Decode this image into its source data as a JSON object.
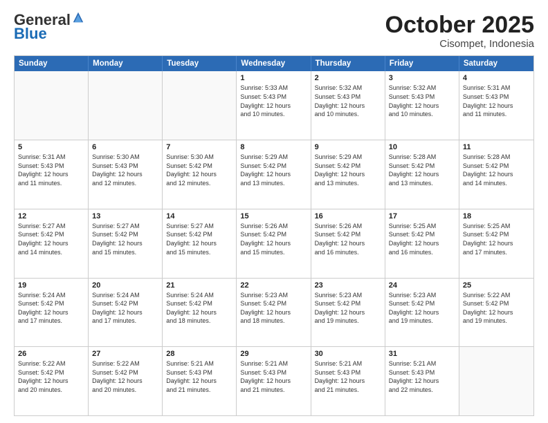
{
  "header": {
    "logo_general": "General",
    "logo_blue": "Blue",
    "month_title": "October 2025",
    "location": "Cisompet, Indonesia"
  },
  "days_of_week": [
    "Sunday",
    "Monday",
    "Tuesday",
    "Wednesday",
    "Thursday",
    "Friday",
    "Saturday"
  ],
  "rows": [
    [
      {
        "day": "",
        "info": ""
      },
      {
        "day": "",
        "info": ""
      },
      {
        "day": "",
        "info": ""
      },
      {
        "day": "1",
        "info": "Sunrise: 5:33 AM\nSunset: 5:43 PM\nDaylight: 12 hours\nand 10 minutes."
      },
      {
        "day": "2",
        "info": "Sunrise: 5:32 AM\nSunset: 5:43 PM\nDaylight: 12 hours\nand 10 minutes."
      },
      {
        "day": "3",
        "info": "Sunrise: 5:32 AM\nSunset: 5:43 PM\nDaylight: 12 hours\nand 10 minutes."
      },
      {
        "day": "4",
        "info": "Sunrise: 5:31 AM\nSunset: 5:43 PM\nDaylight: 12 hours\nand 11 minutes."
      }
    ],
    [
      {
        "day": "5",
        "info": "Sunrise: 5:31 AM\nSunset: 5:43 PM\nDaylight: 12 hours\nand 11 minutes."
      },
      {
        "day": "6",
        "info": "Sunrise: 5:30 AM\nSunset: 5:43 PM\nDaylight: 12 hours\nand 12 minutes."
      },
      {
        "day": "7",
        "info": "Sunrise: 5:30 AM\nSunset: 5:42 PM\nDaylight: 12 hours\nand 12 minutes."
      },
      {
        "day": "8",
        "info": "Sunrise: 5:29 AM\nSunset: 5:42 PM\nDaylight: 12 hours\nand 13 minutes."
      },
      {
        "day": "9",
        "info": "Sunrise: 5:29 AM\nSunset: 5:42 PM\nDaylight: 12 hours\nand 13 minutes."
      },
      {
        "day": "10",
        "info": "Sunrise: 5:28 AM\nSunset: 5:42 PM\nDaylight: 12 hours\nand 13 minutes."
      },
      {
        "day": "11",
        "info": "Sunrise: 5:28 AM\nSunset: 5:42 PM\nDaylight: 12 hours\nand 14 minutes."
      }
    ],
    [
      {
        "day": "12",
        "info": "Sunrise: 5:27 AM\nSunset: 5:42 PM\nDaylight: 12 hours\nand 14 minutes."
      },
      {
        "day": "13",
        "info": "Sunrise: 5:27 AM\nSunset: 5:42 PM\nDaylight: 12 hours\nand 15 minutes."
      },
      {
        "day": "14",
        "info": "Sunrise: 5:27 AM\nSunset: 5:42 PM\nDaylight: 12 hours\nand 15 minutes."
      },
      {
        "day": "15",
        "info": "Sunrise: 5:26 AM\nSunset: 5:42 PM\nDaylight: 12 hours\nand 15 minutes."
      },
      {
        "day": "16",
        "info": "Sunrise: 5:26 AM\nSunset: 5:42 PM\nDaylight: 12 hours\nand 16 minutes."
      },
      {
        "day": "17",
        "info": "Sunrise: 5:25 AM\nSunset: 5:42 PM\nDaylight: 12 hours\nand 16 minutes."
      },
      {
        "day": "18",
        "info": "Sunrise: 5:25 AM\nSunset: 5:42 PM\nDaylight: 12 hours\nand 17 minutes."
      }
    ],
    [
      {
        "day": "19",
        "info": "Sunrise: 5:24 AM\nSunset: 5:42 PM\nDaylight: 12 hours\nand 17 minutes."
      },
      {
        "day": "20",
        "info": "Sunrise: 5:24 AM\nSunset: 5:42 PM\nDaylight: 12 hours\nand 17 minutes."
      },
      {
        "day": "21",
        "info": "Sunrise: 5:24 AM\nSunset: 5:42 PM\nDaylight: 12 hours\nand 18 minutes."
      },
      {
        "day": "22",
        "info": "Sunrise: 5:23 AM\nSunset: 5:42 PM\nDaylight: 12 hours\nand 18 minutes."
      },
      {
        "day": "23",
        "info": "Sunrise: 5:23 AM\nSunset: 5:42 PM\nDaylight: 12 hours\nand 19 minutes."
      },
      {
        "day": "24",
        "info": "Sunrise: 5:23 AM\nSunset: 5:42 PM\nDaylight: 12 hours\nand 19 minutes."
      },
      {
        "day": "25",
        "info": "Sunrise: 5:22 AM\nSunset: 5:42 PM\nDaylight: 12 hours\nand 19 minutes."
      }
    ],
    [
      {
        "day": "26",
        "info": "Sunrise: 5:22 AM\nSunset: 5:42 PM\nDaylight: 12 hours\nand 20 minutes."
      },
      {
        "day": "27",
        "info": "Sunrise: 5:22 AM\nSunset: 5:42 PM\nDaylight: 12 hours\nand 20 minutes."
      },
      {
        "day": "28",
        "info": "Sunrise: 5:21 AM\nSunset: 5:43 PM\nDaylight: 12 hours\nand 21 minutes."
      },
      {
        "day": "29",
        "info": "Sunrise: 5:21 AM\nSunset: 5:43 PM\nDaylight: 12 hours\nand 21 minutes."
      },
      {
        "day": "30",
        "info": "Sunrise: 5:21 AM\nSunset: 5:43 PM\nDaylight: 12 hours\nand 21 minutes."
      },
      {
        "day": "31",
        "info": "Sunrise: 5:21 AM\nSunset: 5:43 PM\nDaylight: 12 hours\nand 22 minutes."
      },
      {
        "day": "",
        "info": ""
      }
    ]
  ]
}
